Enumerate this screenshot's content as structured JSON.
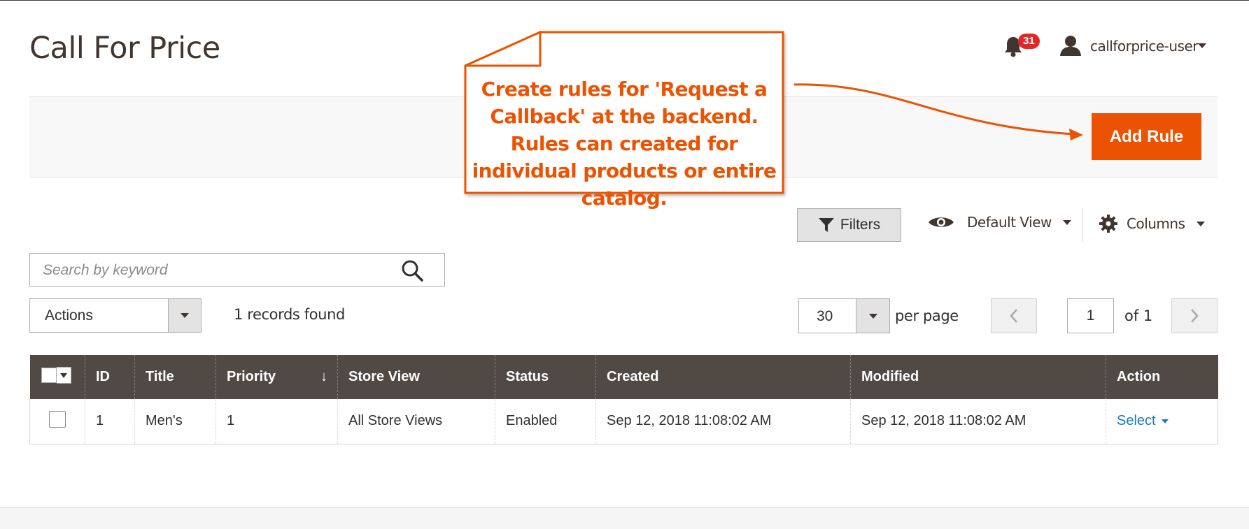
{
  "page": {
    "title": "Call For Price"
  },
  "header": {
    "notifications_count": "31",
    "user_name": "callforprice-user"
  },
  "toolbar": {
    "add_rule_label": "Add Rule"
  },
  "callout": {
    "text": "Create rules for 'Request a Callback' at the backend. Rules can created for individual products or entire catalog.",
    "color": "#eb5202"
  },
  "grid_controls": {
    "filters_label": "Filters",
    "view_label": "Default View",
    "columns_label": "Columns",
    "search_placeholder": "Search by keyword",
    "search_value": "",
    "actions_label": "Actions",
    "records_found": "1 records found",
    "per_page_value": "30",
    "per_page_label": "per page",
    "current_page": "1",
    "page_of": "of 1"
  },
  "table": {
    "columns": [
      "ID",
      "Title",
      "Priority",
      "Store View",
      "Status",
      "Created",
      "Modified",
      "Action"
    ],
    "sort_indicator": "↓",
    "rows": [
      {
        "id": "1",
        "title": "Men's",
        "priority": "1",
        "store_view": "All Store Views",
        "status": "Enabled",
        "created": "Sep 12, 2018 11:08:02 AM",
        "modified": "Sep 12, 2018 11:08:02 AM",
        "action": "Select"
      }
    ]
  },
  "colors": {
    "accent": "#eb5202",
    "table_header": "#514943",
    "link": "#1979c3",
    "badge": "#e22626"
  },
  "icons": [
    "bell-icon",
    "user-icon",
    "filter-icon",
    "eye-icon",
    "gear-icon",
    "search-icon",
    "chevron-left-icon",
    "chevron-right-icon"
  ]
}
